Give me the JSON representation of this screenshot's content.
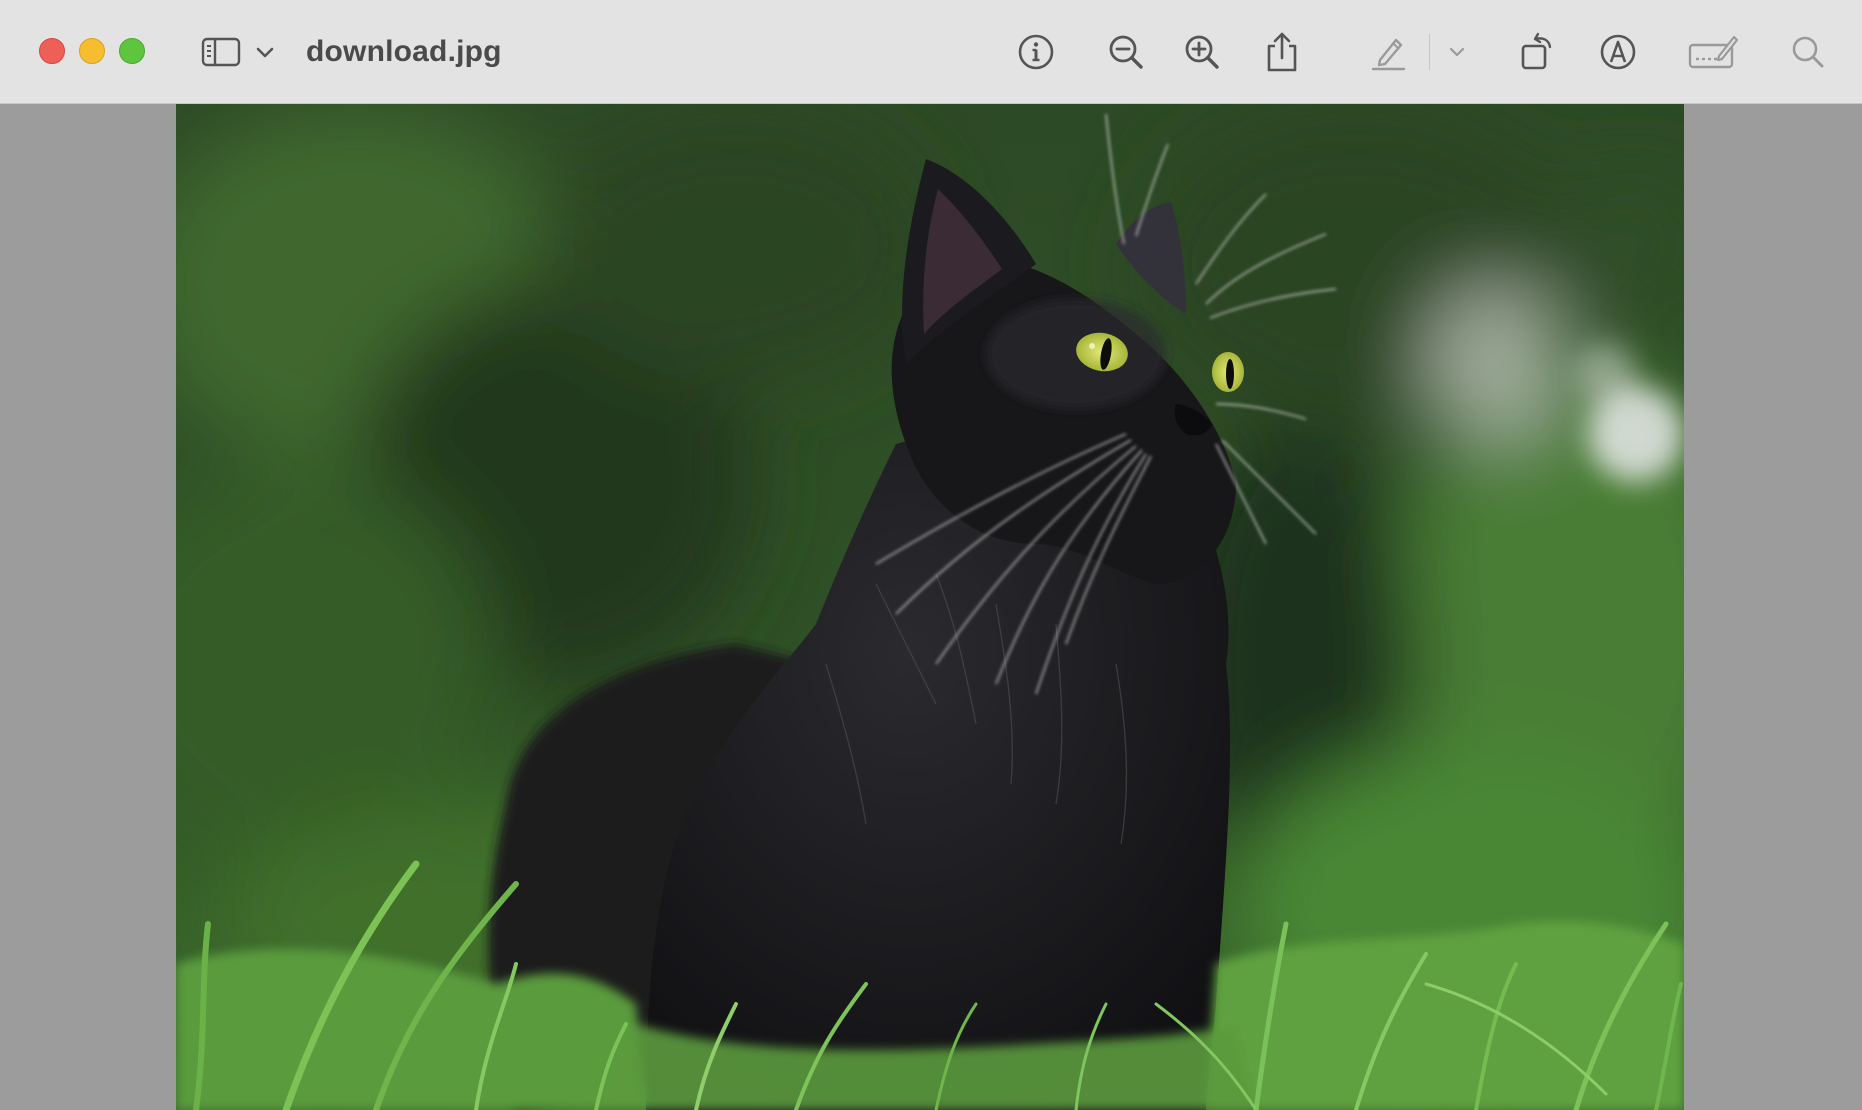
{
  "window": {
    "title": "download.jpg"
  },
  "toolbar": {
    "sidebar_icon": "sidebar-toggle-icon",
    "sidebar_menu_icon": "chevron-down-icon",
    "info_icon": "info-icon",
    "zoom_out_icon": "zoom-out-icon",
    "zoom_in_icon": "zoom-in-icon",
    "share_icon": "share-icon",
    "markup_icon": "highlighter-pen-icon",
    "markup_menu_icon": "chevron-down-icon",
    "rotate_icon": "rotate-icon",
    "annotate_icon": "markup-pen-circle-icon",
    "sign_icon": "signature-icon",
    "search_icon": "search-icon"
  },
  "colors": {
    "titlebar": "#e3e3e3",
    "close": "#ee5f57",
    "minimize": "#f5bd2f",
    "zoom": "#5fc53f",
    "canvas": "#9c9c9c"
  }
}
